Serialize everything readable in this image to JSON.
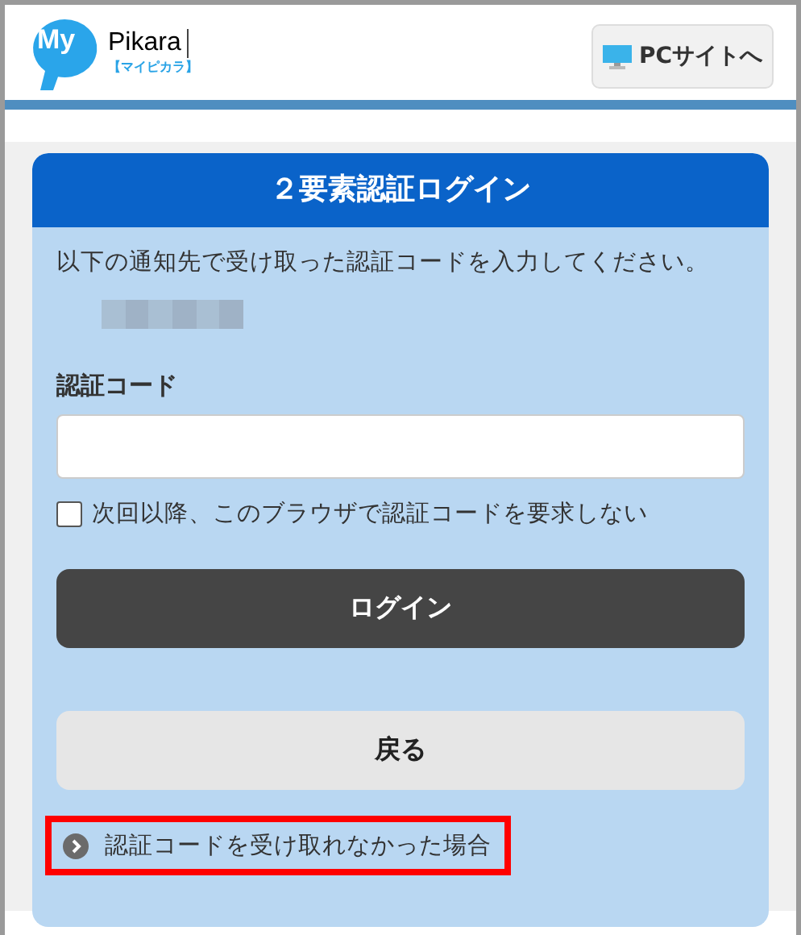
{
  "header": {
    "logo": {
      "mark": "My",
      "name": "Pikara",
      "reading": "【マイピカラ】"
    },
    "pc_site_button": "PCサイトへ"
  },
  "card": {
    "title": "２要素認証ログイン",
    "instruction": "以下の通知先で受け取った認証コードを入力してください。",
    "destination_redacted": true,
    "code_field": {
      "label": "認証コード"
    },
    "remember": {
      "label": "次回以降、このブラウザで認証コードを要求しない",
      "checked": false
    },
    "buttons": [
      {
        "label": "ログイン",
        "kind": "primary"
      },
      {
        "label": "戻る",
        "kind": "secondary"
      }
    ],
    "help_link": {
      "label": "認証コードを受け取れなかった場合",
      "highlighted": true
    }
  }
}
